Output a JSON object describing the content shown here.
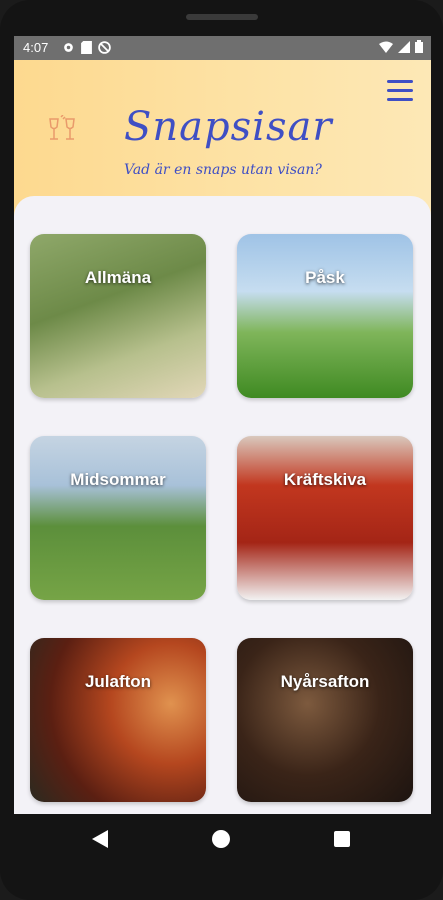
{
  "status_bar": {
    "time": "4:07"
  },
  "header": {
    "title": "Snapsisar",
    "subtitle": "Vad är en snaps utan visan?"
  },
  "categories": [
    {
      "label": "Allmäna"
    },
    {
      "label": "Påsk"
    },
    {
      "label": "Midsommar"
    },
    {
      "label": "Kräftskiva"
    },
    {
      "label": "Julafton"
    },
    {
      "label": "Nyårsafton"
    }
  ],
  "colors": {
    "accent": "#3f4fc4",
    "header_bg": "#fde3a7",
    "glass_icon": "#e99a6b"
  }
}
